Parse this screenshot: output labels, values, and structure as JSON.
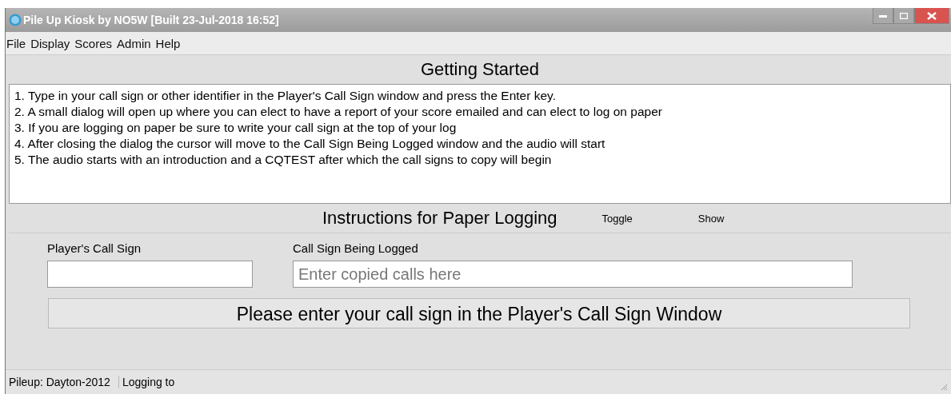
{
  "window": {
    "title": "Pile Up Kiosk by NO5W [Built 23-Jul-2018 16:52]"
  },
  "menu": [
    "File",
    "Display",
    "Scores",
    "Admin",
    "Help"
  ],
  "getting_started": {
    "heading": "Getting Started",
    "lines": [
      "1. Type in your call sign or other identifier in the Player's Call Sign window and press the Enter key.",
      "2. A small dialog will open up where you can elect to have a report of your score emailed and can elect to log on paper",
      "3. If you are logging on paper be sure to write your call sign at the top of your log",
      "4. After closing the dialog the cursor will move to the Call Sign Being Logged window and the audio will start",
      "5. The audio starts with an introduction and a CQTEST after which the call signs to copy will begin"
    ]
  },
  "paper_logging": {
    "heading": "Instructions for Paper Logging",
    "toggle": "Toggle",
    "show": "Show"
  },
  "players_call_sign": {
    "label": "Player's Call Sign"
  },
  "call_sign_being_logged": {
    "label": "Call Sign Being Logged",
    "placeholder": "Enter copied calls here"
  },
  "banner": "Please enter your call sign in the Player's Call Sign Window",
  "status_bar": [
    "Pileup: Dayton-2012",
    "Logging to"
  ]
}
